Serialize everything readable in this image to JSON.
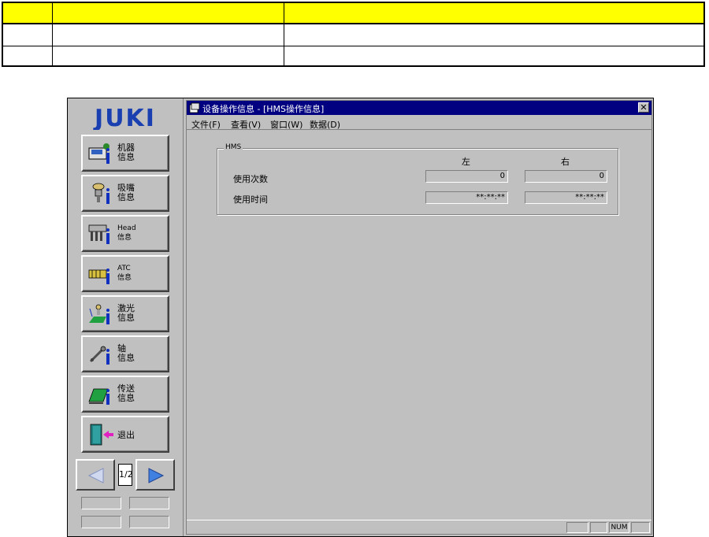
{
  "doc_table": {
    "header": [
      "",
      "",
      ""
    ],
    "rows": [
      [
        "",
        "",
        ""
      ],
      [
        "",
        "",
        ""
      ]
    ]
  },
  "brand": {
    "logo_text": "JUKI",
    "logo_color": "#1a3fb0"
  },
  "sidebar": {
    "items": [
      {
        "label": "机器\n信息",
        "icon": "machine-info-icon"
      },
      {
        "label": "吸嘴\n信息",
        "icon": "nozzle-info-icon"
      },
      {
        "label": "Head\n信息",
        "icon": "head-info-icon"
      },
      {
        "label": "ATC\n信息",
        "icon": "atc-info-icon"
      },
      {
        "label": "激光\n信息",
        "icon": "laser-info-icon"
      },
      {
        "label": "轴\n信息",
        "icon": "axis-info-icon"
      },
      {
        "label": "传送\n信息",
        "icon": "conveyor-info-icon"
      },
      {
        "label": "退出",
        "icon": "exit-door-icon"
      }
    ],
    "page_indicator": "1/2"
  },
  "window": {
    "title": "设备操作信息 - [HMS操作信息]",
    "menu": [
      "文件(F)",
      "查看(V)",
      "窗口(W)",
      "数据(D)"
    ]
  },
  "hms": {
    "group_title": "HMS",
    "col_left": "左",
    "col_right": "右",
    "rows": [
      {
        "label": "使用次数",
        "left": "0",
        "right": "0"
      },
      {
        "label": "使用时间",
        "left": "**:**:**",
        "right": "**:**:**"
      }
    ]
  },
  "statusbar": {
    "num_indicator": "NUM"
  }
}
